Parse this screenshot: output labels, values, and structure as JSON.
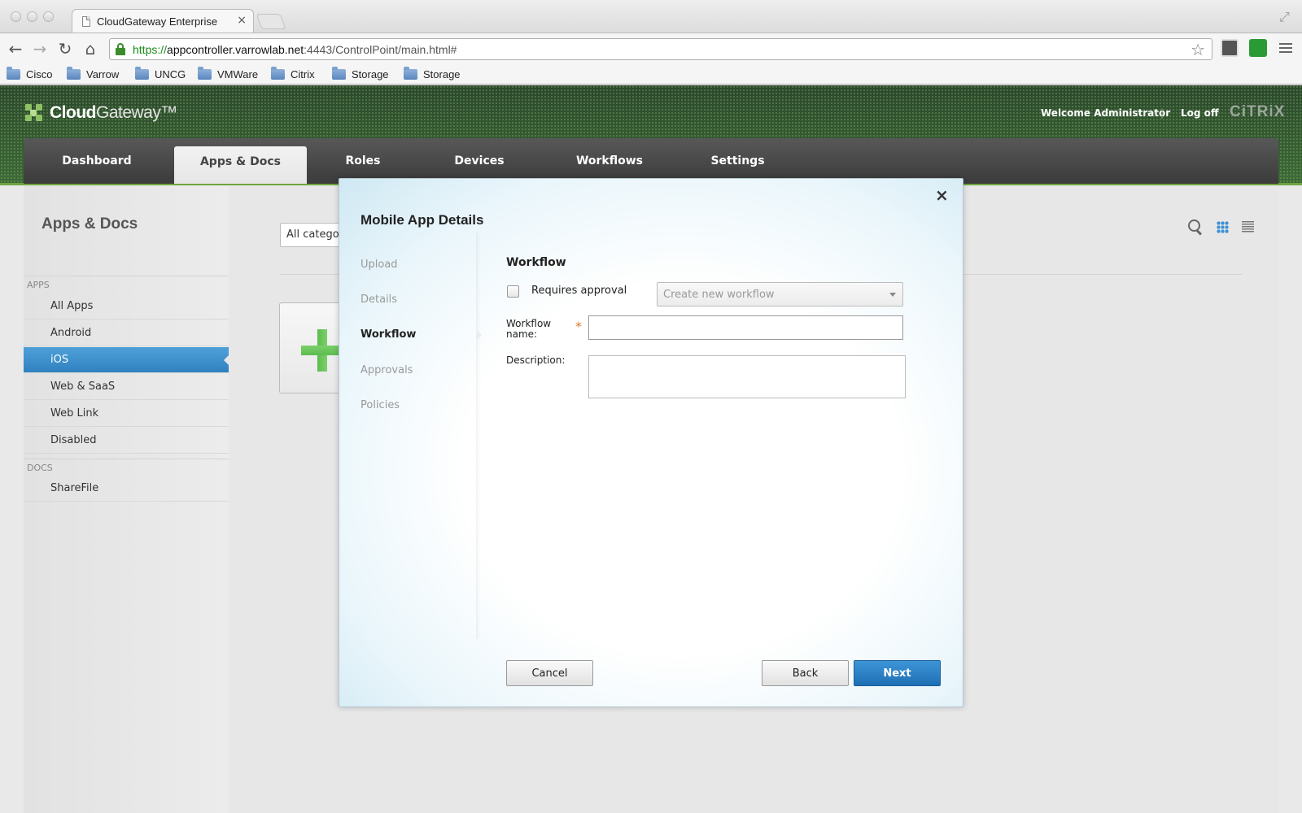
{
  "browser": {
    "tab_title": "CloudGateway Enterprise",
    "tab_close": "×",
    "url_scheme": "https://",
    "url_host": "appcontroller.varrowlab.net",
    "url_path": ":4443/ControlPoint/main.html#",
    "nav": {
      "back": "←",
      "forward": "→",
      "reload": "↻",
      "home": "⌂"
    },
    "star": "☆",
    "bookmarks": [
      "Cisco",
      "Varrow",
      "UNCG",
      "VMWare",
      "Citrix",
      "Storage",
      "Storage"
    ]
  },
  "header": {
    "logo_bold": "Cloud",
    "logo_light": "Gateway™",
    "welcome": "Welcome Administrator",
    "separator": "|",
    "logoff": "Log off",
    "vendor_logo": "CiTRiX"
  },
  "main_nav": {
    "tabs": [
      {
        "label": "Dashboard"
      },
      {
        "label": "Apps & Docs"
      },
      {
        "label": "Roles"
      },
      {
        "label": "Devices"
      },
      {
        "label": "Workflows"
      },
      {
        "label": "Settings"
      }
    ],
    "active": "Apps & Docs"
  },
  "sidebar": {
    "title": "Apps & Docs",
    "apps_section": "APPS",
    "apps_items": [
      "All Apps",
      "Android",
      "iOS",
      "Web & SaaS",
      "Web Link",
      "Disabled"
    ],
    "active_item": "iOS",
    "docs_section": "DOCS",
    "docs_items": [
      "ShareFile"
    ]
  },
  "content": {
    "category_filter": "All categories"
  },
  "modal": {
    "title": "Mobile App Details",
    "close": "×",
    "steps": [
      "Upload",
      "Details",
      "Workflow",
      "Approvals",
      "Policies"
    ],
    "current_step": "Workflow",
    "section_heading": "Workflow",
    "requires_approval_label": "Requires approval",
    "requires_approval_checked": false,
    "workflow_select_value": "Create new workflow",
    "workflow_name_label": "Workflow name:",
    "required_marker": "*",
    "workflow_name_value": "",
    "description_label": "Description:",
    "description_value": "",
    "buttons": {
      "cancel": "Cancel",
      "back": "Back",
      "next": "Next"
    }
  },
  "colors": {
    "accent_blue": "#2f82c0",
    "header_green": "#2d4a2e",
    "required_orange": "#e07a2c"
  }
}
